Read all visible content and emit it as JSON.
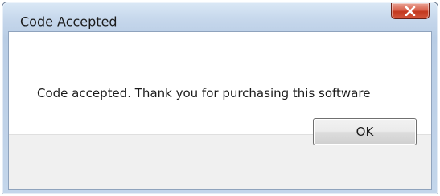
{
  "window": {
    "title": "Code Accepted",
    "close_icon": "close-icon"
  },
  "dialog": {
    "message": "Code accepted. Thank you for purchasing this software",
    "ok_label": "OK"
  },
  "colors": {
    "titlebar": "#c7d8ec",
    "close_button": "#c3381f",
    "content_background": "#ffffff",
    "footer_background": "#f0f0f0"
  }
}
